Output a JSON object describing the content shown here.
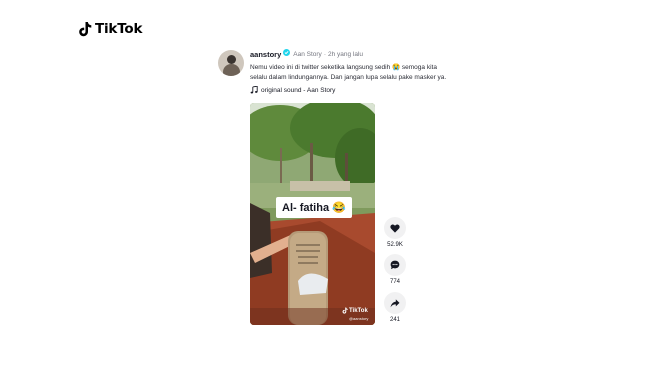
{
  "logo": {
    "text": "TikTok",
    "icon": "tiktok-note-icon"
  },
  "post": {
    "username": "aanstory",
    "author_name": "Aan Story",
    "time": "2h yang lalu",
    "separator": "·",
    "caption_line1": "Nemu video ini di twitter seketika langsung sedih 😭 semoga kita",
    "caption_line2": "selalu dalam lindungannya. Dan jangan lupa selalu pake masker ya.",
    "sound": "original sound - Aan Story"
  },
  "video": {
    "overlay_text": "Al- fatiha 😂",
    "watermark": "TikTok",
    "watermark_user": "@aanstory"
  },
  "actions": {
    "likes": "52.9K",
    "comments": "774",
    "shares": "241"
  },
  "colors": {
    "verified": "#20d5ec",
    "button_bg": "#f1f1f2"
  }
}
